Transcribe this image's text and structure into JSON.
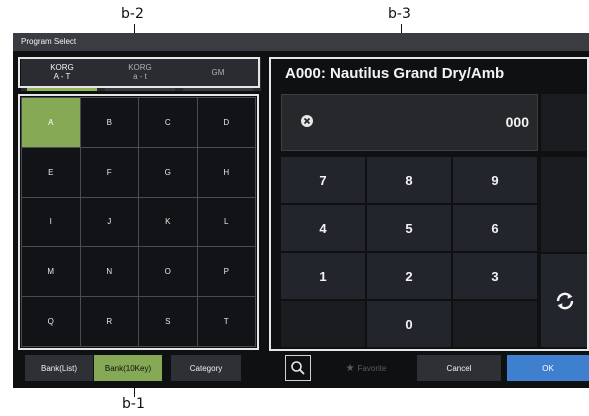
{
  "callouts": {
    "b2": "b-2",
    "b3": "b-3",
    "b1": "b-1"
  },
  "window": {
    "title": "Program Select"
  },
  "bank_tabs": [
    {
      "line1": "KORG",
      "line2": "A - T",
      "active": true
    },
    {
      "line1": "KORG",
      "line2": "a - t",
      "active": false
    },
    {
      "line1": "GM",
      "line2": "",
      "active": false
    }
  ],
  "letters": [
    "A",
    "B",
    "C",
    "D",
    "E",
    "F",
    "G",
    "H",
    "I",
    "J",
    "K",
    "L",
    "M",
    "N",
    "O",
    "P",
    "Q",
    "R",
    "S",
    "T"
  ],
  "selected_letter": "A",
  "bottom_left": {
    "bank_list": "Bank(List)",
    "bank_10key": "Bank(10Key)",
    "category": "Category"
  },
  "program": {
    "name": "A000: Nautilus Grand Dry/Amb",
    "number": "000"
  },
  "keypad": [
    "7",
    "8",
    "9",
    "4",
    "5",
    "6",
    "1",
    "2",
    "3",
    "0"
  ],
  "bottom_right": {
    "favorite": "Favorite",
    "cancel": "Cancel",
    "ok": "OK"
  },
  "colors": {
    "accent_green": "#86a955",
    "ok_blue": "#3f7fd0",
    "background": "#0f1012"
  }
}
